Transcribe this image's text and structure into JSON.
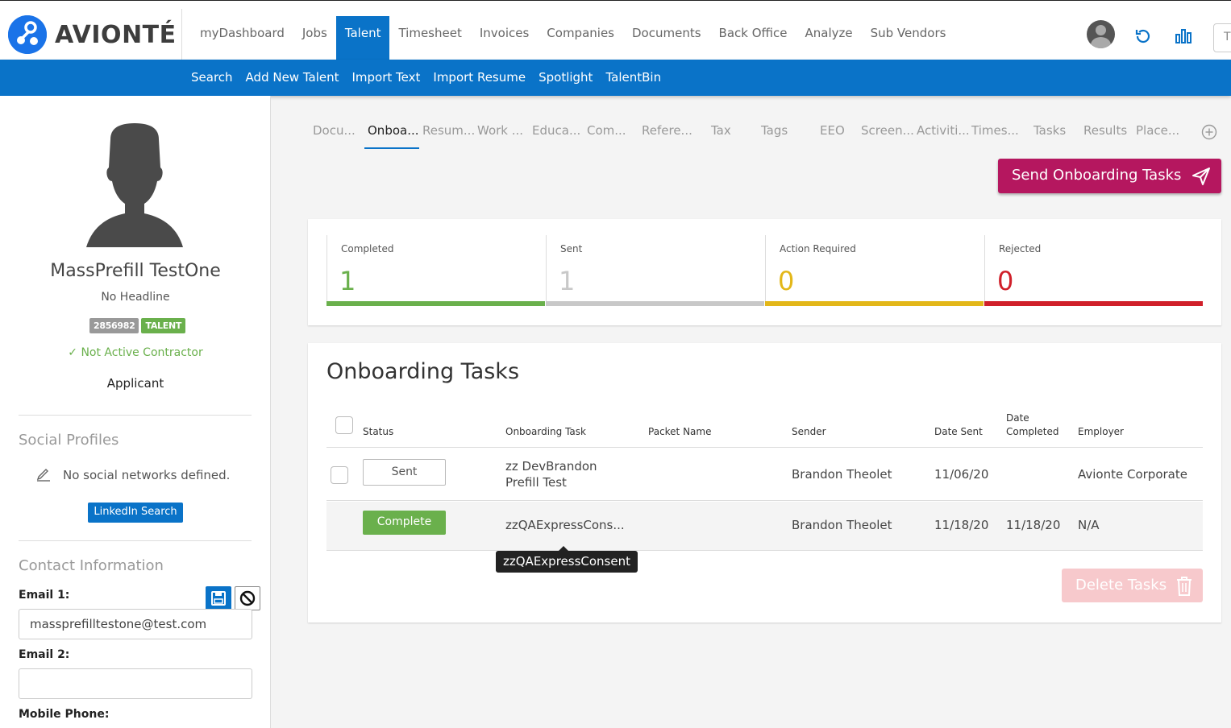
{
  "brand": {
    "logo_text": "AVIONTÉ",
    "logo_color": "#1a73e8"
  },
  "main_nav": {
    "items": [
      {
        "label": "myDashboard"
      },
      {
        "label": "Jobs"
      },
      {
        "label": "Talent",
        "active": true
      },
      {
        "label": "Timesheet"
      },
      {
        "label": "Invoices"
      },
      {
        "label": "Companies"
      },
      {
        "label": "Documents"
      },
      {
        "label": "Back Office"
      },
      {
        "label": "Analyze"
      },
      {
        "label": "Sub Vendors"
      }
    ],
    "search_placeholder": "T"
  },
  "sub_nav": {
    "items": [
      {
        "label": "Search"
      },
      {
        "label": "Add New Talent"
      },
      {
        "label": "Import Text"
      },
      {
        "label": "Import Resume"
      },
      {
        "label": "Spotlight"
      },
      {
        "label": "TalentBin"
      }
    ]
  },
  "profile": {
    "name": "MassPrefill TestOne",
    "headline": "No Headline",
    "id_badge": "2856982",
    "type_badge": "TALENT",
    "contractor_status": "Not Active Contractor",
    "role": "Applicant"
  },
  "social": {
    "title": "Social Profiles",
    "empty_text": "No social networks defined.",
    "linkedin_button": "LinkedIn Search"
  },
  "contact": {
    "title": "Contact Information",
    "email1_label": "Email 1:",
    "email1_value": "massprefilltestone@test.com",
    "email2_label": "Email 2:",
    "email2_value": "",
    "mobile_label": "Mobile Phone:"
  },
  "tabs": [
    {
      "label": "Docu..."
    },
    {
      "label": "Onboa...",
      "active": true
    },
    {
      "label": "Resum..."
    },
    {
      "label": "Work ..."
    },
    {
      "label": "Educa..."
    },
    {
      "label": "Com..."
    },
    {
      "label": "Refere..."
    },
    {
      "label": "Tax"
    },
    {
      "label": "Tags"
    },
    {
      "label": "EEO"
    },
    {
      "label": "Screen..."
    },
    {
      "label": "Activiti..."
    },
    {
      "label": "Times..."
    },
    {
      "label": "Tasks"
    },
    {
      "label": "Results"
    },
    {
      "label": "Place..."
    }
  ],
  "send_button": "Send Onboarding Tasks",
  "stats": [
    {
      "label": "Completed",
      "value": "1",
      "color": "#6ab04c"
    },
    {
      "label": "Sent",
      "value": "1",
      "color": "#c8c8c8"
    },
    {
      "label": "Action Required",
      "value": "0",
      "color": "#e3b719"
    },
    {
      "label": "Rejected",
      "value": "0",
      "color": "#d0202a"
    }
  ],
  "tasks": {
    "title": "Onboarding Tasks",
    "columns": {
      "status": "Status",
      "task": "Onboarding Task",
      "packet": "Packet Name",
      "sender": "Sender",
      "date_sent": "Date Sent",
      "date_completed_1": "Date",
      "date_completed_2": "Completed",
      "employer": "Employer"
    },
    "rows": [
      {
        "status": "Sent",
        "task_line1": "zz DevBrandon",
        "task_line2": "Prefill Test",
        "packet": "",
        "sender": "Brandon Theolet",
        "date_sent": "11/06/20",
        "date_completed": "",
        "employer": "Avionte Corporate"
      },
      {
        "status": "Complete",
        "task_line1": "zzQAExpressCons...",
        "task_line2": "",
        "packet": "",
        "sender": "Brandon Theolet",
        "date_sent": "11/18/20",
        "date_completed": "11/18/20",
        "employer": "N/A"
      }
    ],
    "tooltip": "zzQAExpressConsent",
    "delete_button": "Delete Tasks"
  }
}
